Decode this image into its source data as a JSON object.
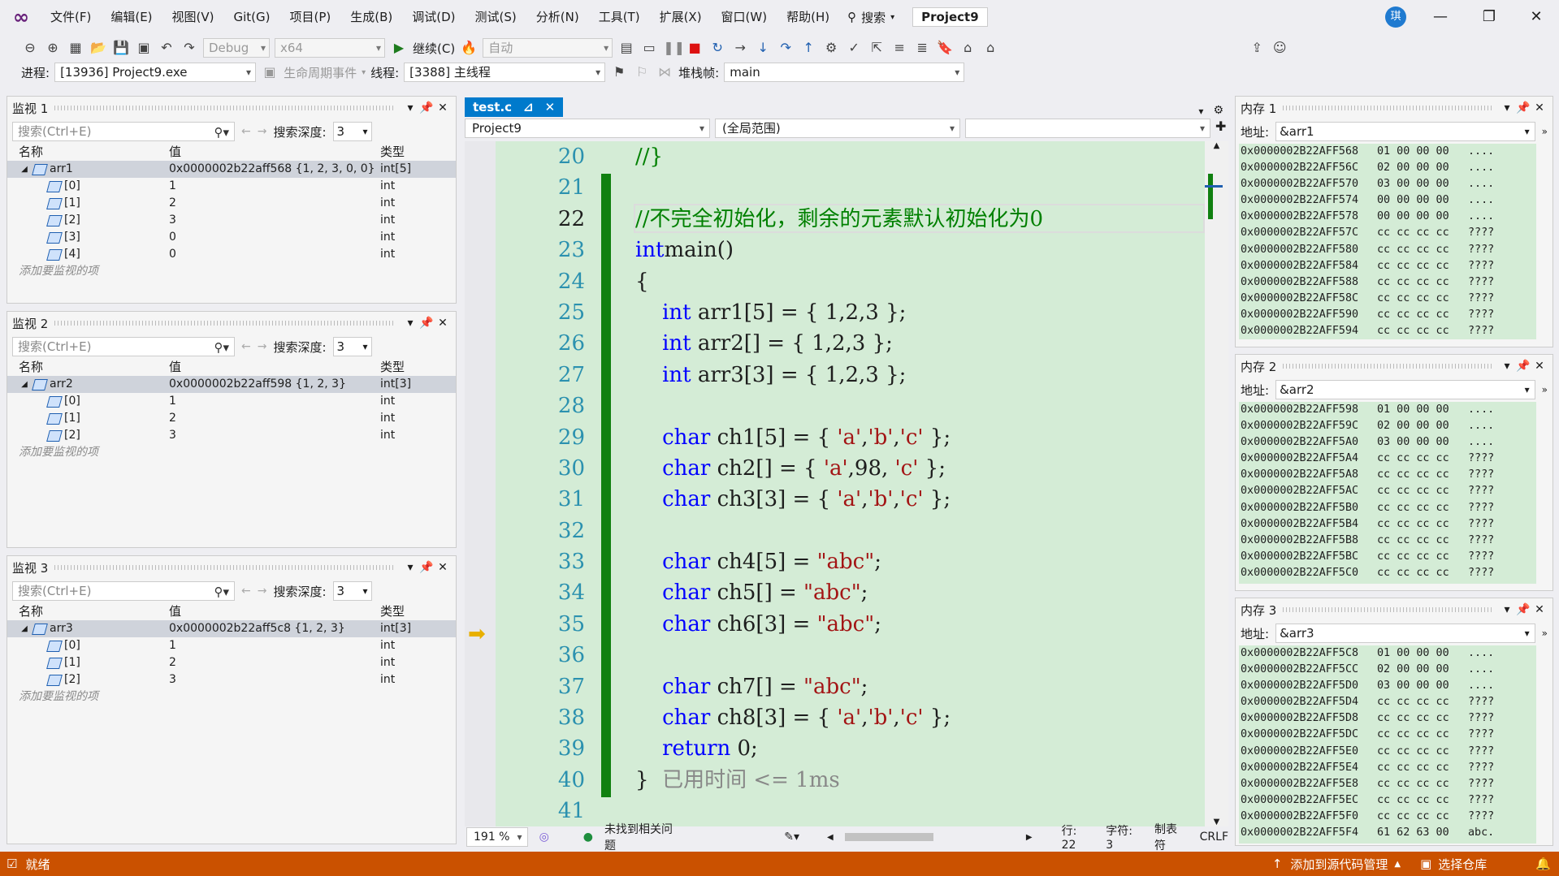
{
  "menubar": {
    "items": [
      "文件(F)",
      "编辑(E)",
      "视图(V)",
      "Git(G)",
      "项目(P)",
      "生成(B)",
      "调试(D)",
      "测试(S)",
      "分析(N)",
      "工具(T)",
      "扩展(X)",
      "窗口(W)",
      "帮助(H)"
    ],
    "search_label": "搜索",
    "project": "Project9",
    "avatar": "琪"
  },
  "toolbar": {
    "config": "Debug",
    "platform": "x64",
    "continue": "继续(C)",
    "auto": "自动",
    "process_label": "进程:",
    "process": "[13936] Project9.exe",
    "lifecycle": "生命周期事件",
    "thread_label": "线程:",
    "thread": "[3388] 主线程",
    "stack_label": "堆栈帧:",
    "stack": "main"
  },
  "watch_common": {
    "search_placeholder": "搜索(Ctrl+E)",
    "depth_label": "搜索深度:",
    "depth": "3",
    "col_name": "名称",
    "col_value": "值",
    "col_type": "类型",
    "add_hint": "添加要监视的项"
  },
  "watch1": {
    "title": "监视 1",
    "rows": [
      {
        "name": "arr1",
        "value": "0x0000002b22aff568 {1, 2, 3, 0, 0}",
        "type": "int[5]",
        "root": true
      },
      {
        "name": "[0]",
        "value": "1",
        "type": "int"
      },
      {
        "name": "[1]",
        "value": "2",
        "type": "int"
      },
      {
        "name": "[2]",
        "value": "3",
        "type": "int"
      },
      {
        "name": "[3]",
        "value": "0",
        "type": "int"
      },
      {
        "name": "[4]",
        "value": "0",
        "type": "int"
      }
    ]
  },
  "watch2": {
    "title": "监视 2",
    "rows": [
      {
        "name": "arr2",
        "value": "0x0000002b22aff598 {1, 2, 3}",
        "type": "int[3]",
        "root": true
      },
      {
        "name": "[0]",
        "value": "1",
        "type": "int"
      },
      {
        "name": "[1]",
        "value": "2",
        "type": "int"
      },
      {
        "name": "[2]",
        "value": "3",
        "type": "int"
      }
    ]
  },
  "watch3": {
    "title": "监视 3",
    "rows": [
      {
        "name": "arr3",
        "value": "0x0000002b22aff5c8 {1, 2, 3}",
        "type": "int[3]",
        "root": true
      },
      {
        "name": "[0]",
        "value": "1",
        "type": "int"
      },
      {
        "name": "[1]",
        "value": "2",
        "type": "int"
      },
      {
        "name": "[2]",
        "value": "3",
        "type": "int"
      }
    ]
  },
  "editor": {
    "tab": "test.c",
    "nav_project": "Project9",
    "nav_scope": "(全局范围)",
    "line_numbers": [
      "20",
      "21",
      "22",
      "23",
      "24",
      "25",
      "26",
      "27",
      "28",
      "29",
      "30",
      "31",
      "32",
      "33",
      "34",
      "35",
      "36",
      "37",
      "38",
      "39",
      "40",
      "41"
    ],
    "code": [
      [
        [
          "cm",
          "//}"
        ]
      ],
      [],
      [
        [
          "cm",
          "//不完全初始化，剩余的元素默认初始化为0"
        ]
      ],
      [
        [
          "kw",
          "int"
        ],
        [
          "",
          "main()"
        ]
      ],
      [
        [
          "",
          "{"
        ]
      ],
      [
        [
          "",
          "    "
        ],
        [
          "kw",
          "int"
        ],
        [
          "",
          " arr1[5] = { 1,2,3 };"
        ]
      ],
      [
        [
          "",
          "    "
        ],
        [
          "kw",
          "int"
        ],
        [
          "",
          " arr2[] = { 1,2,3 };"
        ]
      ],
      [
        [
          "",
          "    "
        ],
        [
          "kw",
          "int"
        ],
        [
          "",
          " arr3[3] = { 1,2,3 };"
        ]
      ],
      [],
      [
        [
          "",
          "    "
        ],
        [
          "kw",
          "char"
        ],
        [
          "",
          " ch1[5] = { "
        ],
        [
          "st",
          "'a'"
        ],
        [
          ",",
          ","
        ],
        [
          "st",
          "'b'"
        ],
        [
          "",
          ","
        ],
        [
          "st",
          "'c'"
        ],
        [
          "",
          " };"
        ]
      ],
      [
        [
          "",
          "    "
        ],
        [
          "kw",
          "char"
        ],
        [
          "",
          " ch2[] = { "
        ],
        [
          "st",
          "'a'"
        ],
        [
          "",
          ",98, "
        ],
        [
          "st",
          "'c'"
        ],
        [
          "",
          " };"
        ]
      ],
      [
        [
          "",
          "    "
        ],
        [
          "kw",
          "char"
        ],
        [
          "",
          " ch3[3] = { "
        ],
        [
          "st",
          "'a'"
        ],
        [
          "",
          ","
        ],
        [
          "st",
          "'b'"
        ],
        [
          "",
          ","
        ],
        [
          "st",
          "'c'"
        ],
        [
          "",
          " };"
        ]
      ],
      [],
      [
        [
          "",
          "    "
        ],
        [
          "kw",
          "char"
        ],
        [
          "",
          " ch4[5] = "
        ],
        [
          "st",
          "\"abc\""
        ],
        [
          "",
          ";"
        ]
      ],
      [
        [
          "",
          "    "
        ],
        [
          "kw",
          "char"
        ],
        [
          "",
          " ch5[] = "
        ],
        [
          "st",
          "\"abc\""
        ],
        [
          "",
          ";"
        ]
      ],
      [
        [
          "",
          "    "
        ],
        [
          "kw",
          "char"
        ],
        [
          "",
          " ch6[3] = "
        ],
        [
          "st",
          "\"abc\""
        ],
        [
          "",
          ";"
        ]
      ],
      [],
      [
        [
          "",
          "    "
        ],
        [
          "kw",
          "char"
        ],
        [
          "",
          " ch7[] = "
        ],
        [
          "st",
          "\"abc\""
        ],
        [
          "",
          ";"
        ]
      ],
      [
        [
          "",
          "    "
        ],
        [
          "kw",
          "char"
        ],
        [
          "",
          " ch8[3] = { "
        ],
        [
          "st",
          "'a'"
        ],
        [
          "",
          ","
        ],
        [
          "st",
          "'b'"
        ],
        [
          "",
          ","
        ],
        [
          "st",
          "'c'"
        ],
        [
          "",
          " };"
        ]
      ],
      [
        [
          "",
          "    "
        ],
        [
          "kw",
          "return"
        ],
        [
          "",
          " 0;"
        ]
      ],
      [
        [
          "",
          "}  "
        ],
        [
          "hint",
          "已用时间 <= 1ms"
        ]
      ],
      []
    ]
  },
  "editor_status": {
    "zoom": "191 %",
    "issues": "未找到相关问题",
    "line": "行: 22",
    "char": "字符: 3",
    "tab": "制表符",
    "eol": "CRLF"
  },
  "memory1": {
    "title": "内存 1",
    "address_label": "地址:",
    "address": "&arr1",
    "rows": [
      [
        "0x0000002B22AFF568",
        "01 00 00 00",
        "...."
      ],
      [
        "0x0000002B22AFF56C",
        "02 00 00 00",
        "...."
      ],
      [
        "0x0000002B22AFF570",
        "03 00 00 00",
        "...."
      ],
      [
        "0x0000002B22AFF574",
        "00 00 00 00",
        "...."
      ],
      [
        "0x0000002B22AFF578",
        "00 00 00 00",
        "...."
      ],
      [
        "0x0000002B22AFF57C",
        "cc cc cc cc",
        "????"
      ],
      [
        "0x0000002B22AFF580",
        "cc cc cc cc",
        "????"
      ],
      [
        "0x0000002B22AFF584",
        "cc cc cc cc",
        "????"
      ],
      [
        "0x0000002B22AFF588",
        "cc cc cc cc",
        "????"
      ],
      [
        "0x0000002B22AFF58C",
        "cc cc cc cc",
        "????"
      ],
      [
        "0x0000002B22AFF590",
        "cc cc cc cc",
        "????"
      ],
      [
        "0x0000002B22AFF594",
        "cc cc cc cc",
        "????"
      ]
    ]
  },
  "memory2": {
    "title": "内存 2",
    "address_label": "地址:",
    "address": "&arr2",
    "rows": [
      [
        "0x0000002B22AFF598",
        "01 00 00 00",
        "...."
      ],
      [
        "0x0000002B22AFF59C",
        "02 00 00 00",
        "...."
      ],
      [
        "0x0000002B22AFF5A0",
        "03 00 00 00",
        "...."
      ],
      [
        "0x0000002B22AFF5A4",
        "cc cc cc cc",
        "????"
      ],
      [
        "0x0000002B22AFF5A8",
        "cc cc cc cc",
        "????"
      ],
      [
        "0x0000002B22AFF5AC",
        "cc cc cc cc",
        "????"
      ],
      [
        "0x0000002B22AFF5B0",
        "cc cc cc cc",
        "????"
      ],
      [
        "0x0000002B22AFF5B4",
        "cc cc cc cc",
        "????"
      ],
      [
        "0x0000002B22AFF5B8",
        "cc cc cc cc",
        "????"
      ],
      [
        "0x0000002B22AFF5BC",
        "cc cc cc cc",
        "????"
      ],
      [
        "0x0000002B22AFF5C0",
        "cc cc cc cc",
        "????"
      ]
    ]
  },
  "memory3": {
    "title": "内存 3",
    "address_label": "地址:",
    "address": "&arr3",
    "rows": [
      [
        "0x0000002B22AFF5C8",
        "01 00 00 00",
        "...."
      ],
      [
        "0x0000002B22AFF5CC",
        "02 00 00 00",
        "...."
      ],
      [
        "0x0000002B22AFF5D0",
        "03 00 00 00",
        "...."
      ],
      [
        "0x0000002B22AFF5D4",
        "cc cc cc cc",
        "????"
      ],
      [
        "0x0000002B22AFF5D8",
        "cc cc cc cc",
        "????"
      ],
      [
        "0x0000002B22AFF5DC",
        "cc cc cc cc",
        "????"
      ],
      [
        "0x0000002B22AFF5E0",
        "cc cc cc cc",
        "????"
      ],
      [
        "0x0000002B22AFF5E4",
        "cc cc cc cc",
        "????"
      ],
      [
        "0x0000002B22AFF5E8",
        "cc cc cc cc",
        "????"
      ],
      [
        "0x0000002B22AFF5EC",
        "cc cc cc cc",
        "????"
      ],
      [
        "0x0000002B22AFF5F0",
        "cc cc cc cc",
        "????"
      ],
      [
        "0x0000002B22AFF5F4",
        "61 62 63 00",
        "abc."
      ]
    ]
  },
  "statusbar": {
    "ready": "就绪",
    "add_source": "添加到源代码管理",
    "select_repo": "选择仓库",
    "color": "#ca5100"
  }
}
